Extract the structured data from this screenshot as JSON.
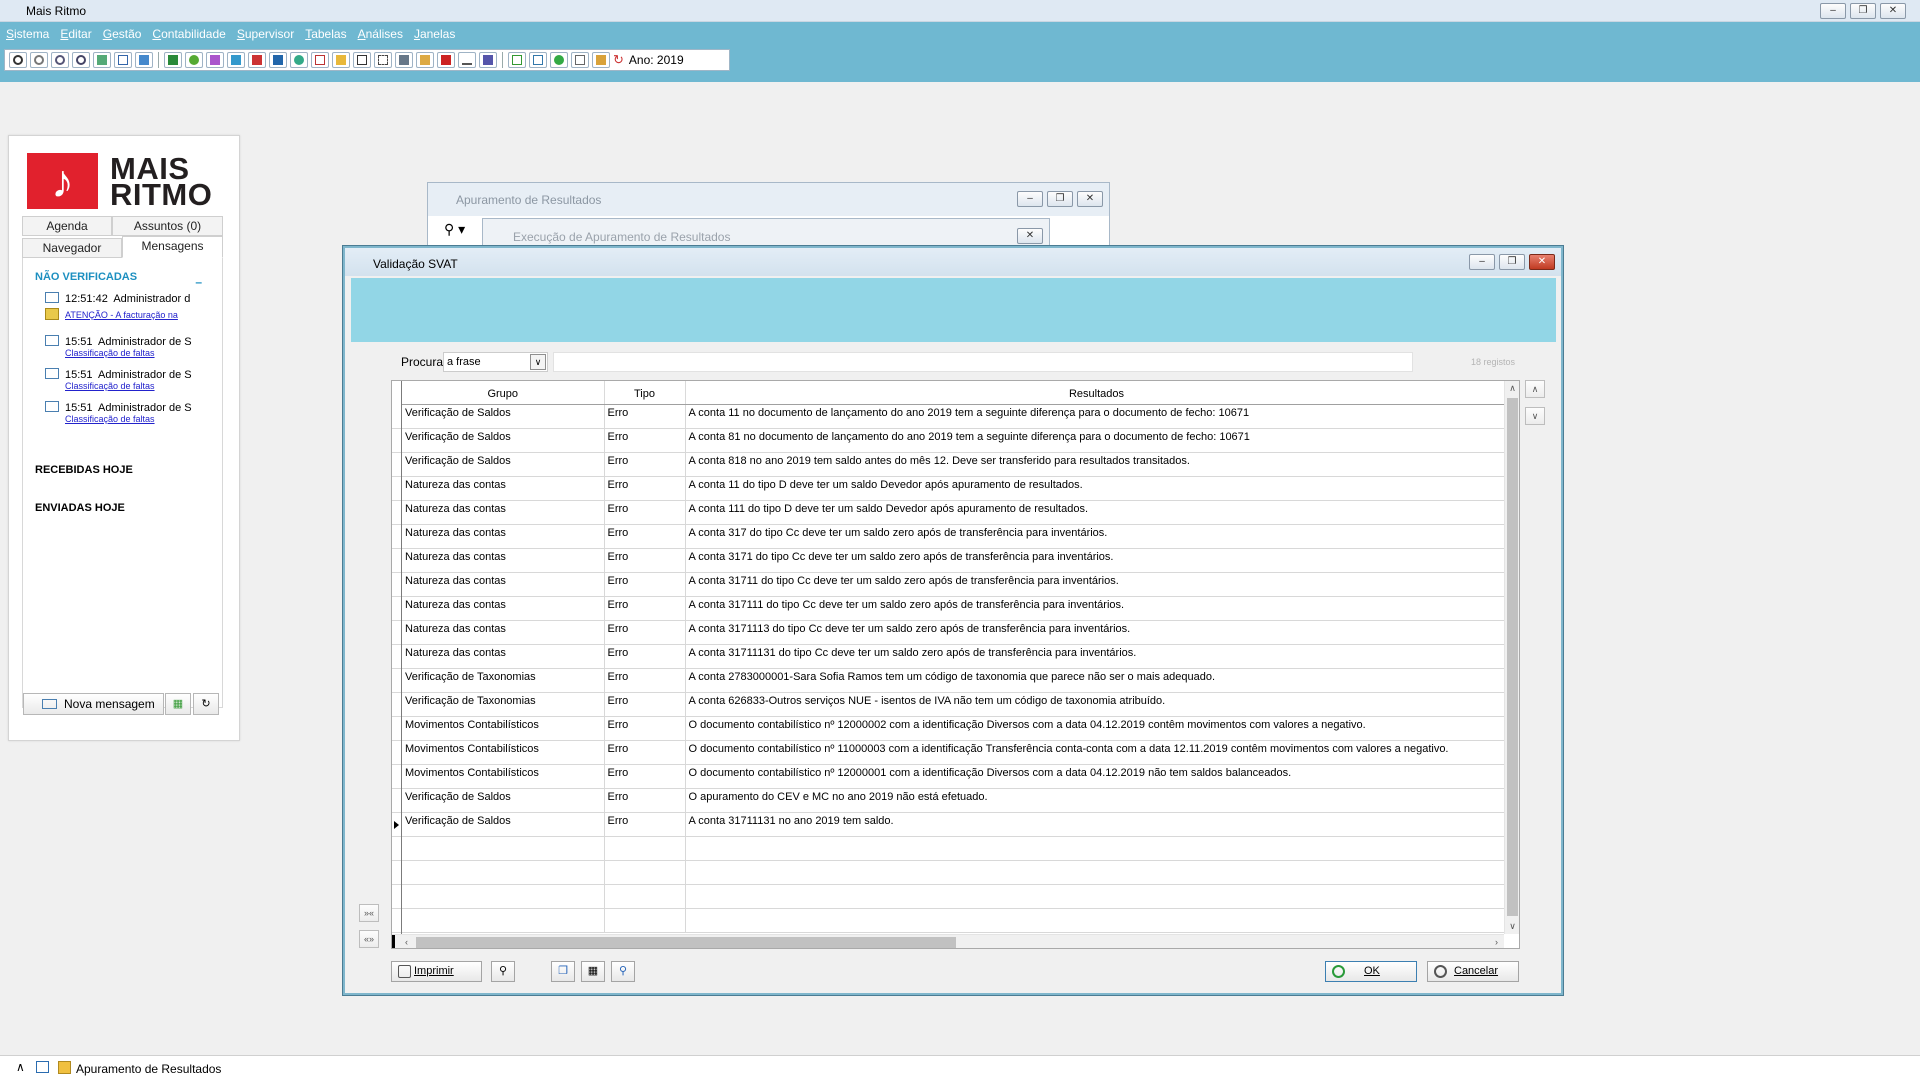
{
  "app": {
    "title": "Mais Ritmo",
    "menu": [
      "Sistema",
      "Editar",
      "Gestão",
      "Contabilidade",
      "Supervisor",
      "Tabelas",
      "Análises",
      "Janelas"
    ],
    "year_label": "Ano: 2019"
  },
  "left_panel": {
    "logo_text_line1": "MAIS",
    "logo_text_line2": "RITMO",
    "tabs": [
      "Agenda",
      "Assuntos (0)",
      "Navegador",
      "Mensagens"
    ],
    "section_unverified": "NÃO VERIFICADAS",
    "collapse_symbol": "–",
    "messages": [
      {
        "time": "12:51:42",
        "sender": "Administrador d",
        "link": "ATENÇÃO - A facturação na"
      },
      {
        "time": "15:51",
        "sender": "Administrador de S",
        "link": "Classificação de faltas"
      },
      {
        "time": "15:51",
        "sender": "Administrador de S",
        "link": "Classificação de faltas"
      },
      {
        "time": "15:51",
        "sender": "Administrador de S",
        "link": "Classificação de faltas"
      }
    ],
    "section_received": "RECEBIDAS HOJE",
    "section_sent": "ENVIADAS HOJE",
    "new_message_label": "Nova mensagem"
  },
  "background_windows": {
    "apuramento_title": "Apuramento de Resultados",
    "execucao_title": "Execução de Apuramento de Resultados"
  },
  "dialog": {
    "title": "Validação SVAT",
    "search": {
      "label": "Procura",
      "mode": "a frase",
      "value": "",
      "count": "18 registos"
    },
    "columns": [
      "Grupo",
      "Tipo",
      "Resultados"
    ],
    "rows": [
      {
        "grupo": "Verificação de Saldos",
        "tipo": "Erro",
        "resultado": "A conta 11 no documento de lançamento do ano 2019 tem a seguinte diferença para o documento de fecho: 10671"
      },
      {
        "grupo": "Verificação de Saldos",
        "tipo": "Erro",
        "resultado": "A conta 81 no documento de lançamento do ano 2019 tem a seguinte diferença para o documento de fecho: 10671"
      },
      {
        "grupo": "Verificação de Saldos",
        "tipo": "Erro",
        "resultado": "A conta 818 no ano 2019 tem saldo antes do mês 12. Deve ser transferido para resultados transitados."
      },
      {
        "grupo": "Natureza das contas",
        "tipo": "Erro",
        "resultado": "A conta 11 do tipo D deve ter um saldo Devedor após apuramento de resultados."
      },
      {
        "grupo": "Natureza das contas",
        "tipo": "Erro",
        "resultado": "A conta 111 do tipo D deve ter um saldo Devedor após apuramento de resultados."
      },
      {
        "grupo": "Natureza das contas",
        "tipo": "Erro",
        "resultado": "A conta 317 do tipo Cc deve ter um saldo zero após de transferência para inventários."
      },
      {
        "grupo": "Natureza das contas",
        "tipo": "Erro",
        "resultado": "A conta 3171 do tipo Cc deve ter um saldo zero após de transferência para inventários."
      },
      {
        "grupo": "Natureza das contas",
        "tipo": "Erro",
        "resultado": "A conta 31711 do tipo Cc deve ter um saldo zero após de transferência para inventários."
      },
      {
        "grupo": "Natureza das contas",
        "tipo": "Erro",
        "resultado": "A conta 317111 do tipo Cc deve ter um saldo zero após de transferência para inventários."
      },
      {
        "grupo": "Natureza das contas",
        "tipo": "Erro",
        "resultado": "A conta 3171113 do tipo Cc deve ter um saldo zero após de transferência para inventários."
      },
      {
        "grupo": "Natureza das contas",
        "tipo": "Erro",
        "resultado": "A conta 31711131 do tipo Cc deve ter um saldo zero após de transferência para inventários."
      },
      {
        "grupo": "Verificação de Taxonomias",
        "tipo": "Erro",
        "resultado": "A conta 2783000001-Sara Sofia Ramos tem um código de taxonomia que parece não ser o mais adequado."
      },
      {
        "grupo": "Verificação de Taxonomias",
        "tipo": "Erro",
        "resultado": "A conta 626833-Outros serviços NUE - isentos de IVA não tem um código de taxonomia atribuído."
      },
      {
        "grupo": "Movimentos Contabilísticos",
        "tipo": "Erro",
        "resultado": "O documento contabilístico nº 12000002 com a identificação Diversos com a data 04.12.2019 contêm movimentos com valores a negativo."
      },
      {
        "grupo": "Movimentos Contabilísticos",
        "tipo": "Erro",
        "resultado": "O documento contabilístico nº 11000003 com a identificação Transferência conta-conta com a data 12.11.2019 contêm movimentos com valores a negativo."
      },
      {
        "grupo": "Movimentos Contabilísticos",
        "tipo": "Erro",
        "resultado": "O documento contabilístico nº 12000001 com a identificação Diversos com a data 04.12.2019 não tem saldos balanceados."
      },
      {
        "grupo": "Verificação de Saldos",
        "tipo": "Erro",
        "resultado": "O apuramento do CEV e MC no ano 2019 não está efetuado."
      },
      {
        "grupo": "Verificação de Saldos",
        "tipo": "Erro",
        "resultado": "A conta 31711131 no ano 2019 tem saldo."
      }
    ],
    "buttons": {
      "print": "Imprimir",
      "ok": "OK",
      "cancel": "Cancelar"
    }
  },
  "statusbar": {
    "task": "Apuramento de Resultados"
  },
  "colors": {
    "chrome": "#6fb8d1",
    "banner": "#92d6e6",
    "logo_red": "#e1212d",
    "section_blue": "#1c8fc0"
  }
}
